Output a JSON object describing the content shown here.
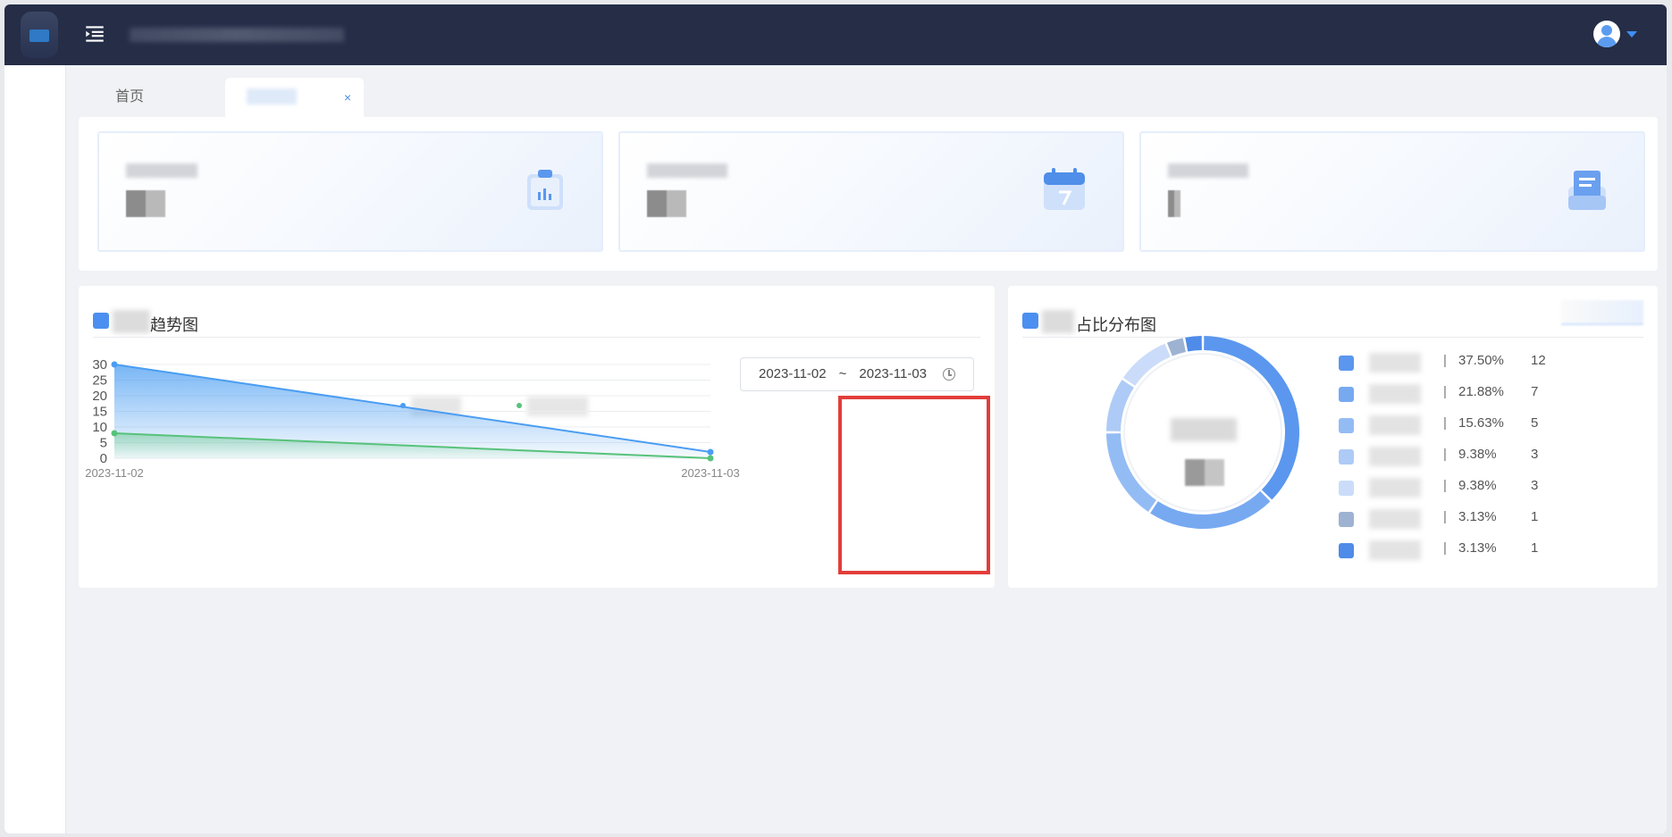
{
  "tabs": {
    "home": "首页",
    "close": "×"
  },
  "panels": {
    "trend_title": "趋势图",
    "dist_title": "占比分布图"
  },
  "date_range": {
    "start": "2023-11-02",
    "separator": "~",
    "end": "2023-11-03"
  },
  "colors": {
    "topbar": "#252d47",
    "accent": "#3f8ef3",
    "series_blue": "#4a9df2",
    "series_green": "#57c27a",
    "annotation": "#e23d3a"
  },
  "chart_data": [
    {
      "type": "line",
      "x": [
        "2023-11-02",
        "2023-11-03"
      ],
      "series": [
        {
          "values": [
            30,
            2
          ]
        },
        {
          "values": [
            8,
            0
          ]
        }
      ],
      "ylim": [
        0,
        30
      ],
      "yticks": [
        0,
        5,
        10,
        15,
        20,
        25,
        30
      ],
      "grid": true,
      "legend": "top-center"
    },
    {
      "type": "pie",
      "values": [
        12,
        7,
        5,
        3,
        3,
        1,
        1
      ],
      "percents": [
        "37.50%",
        "21.88%",
        "15.63%",
        "9.38%",
        "9.38%",
        "3.13%",
        "3.13%"
      ],
      "colors": [
        "#5b97ee",
        "#77a9f1",
        "#94bcf4",
        "#adcbf6",
        "#cadcf9",
        "#9eb2d2",
        "#4f8be8"
      ],
      "legend": "right"
    }
  ]
}
